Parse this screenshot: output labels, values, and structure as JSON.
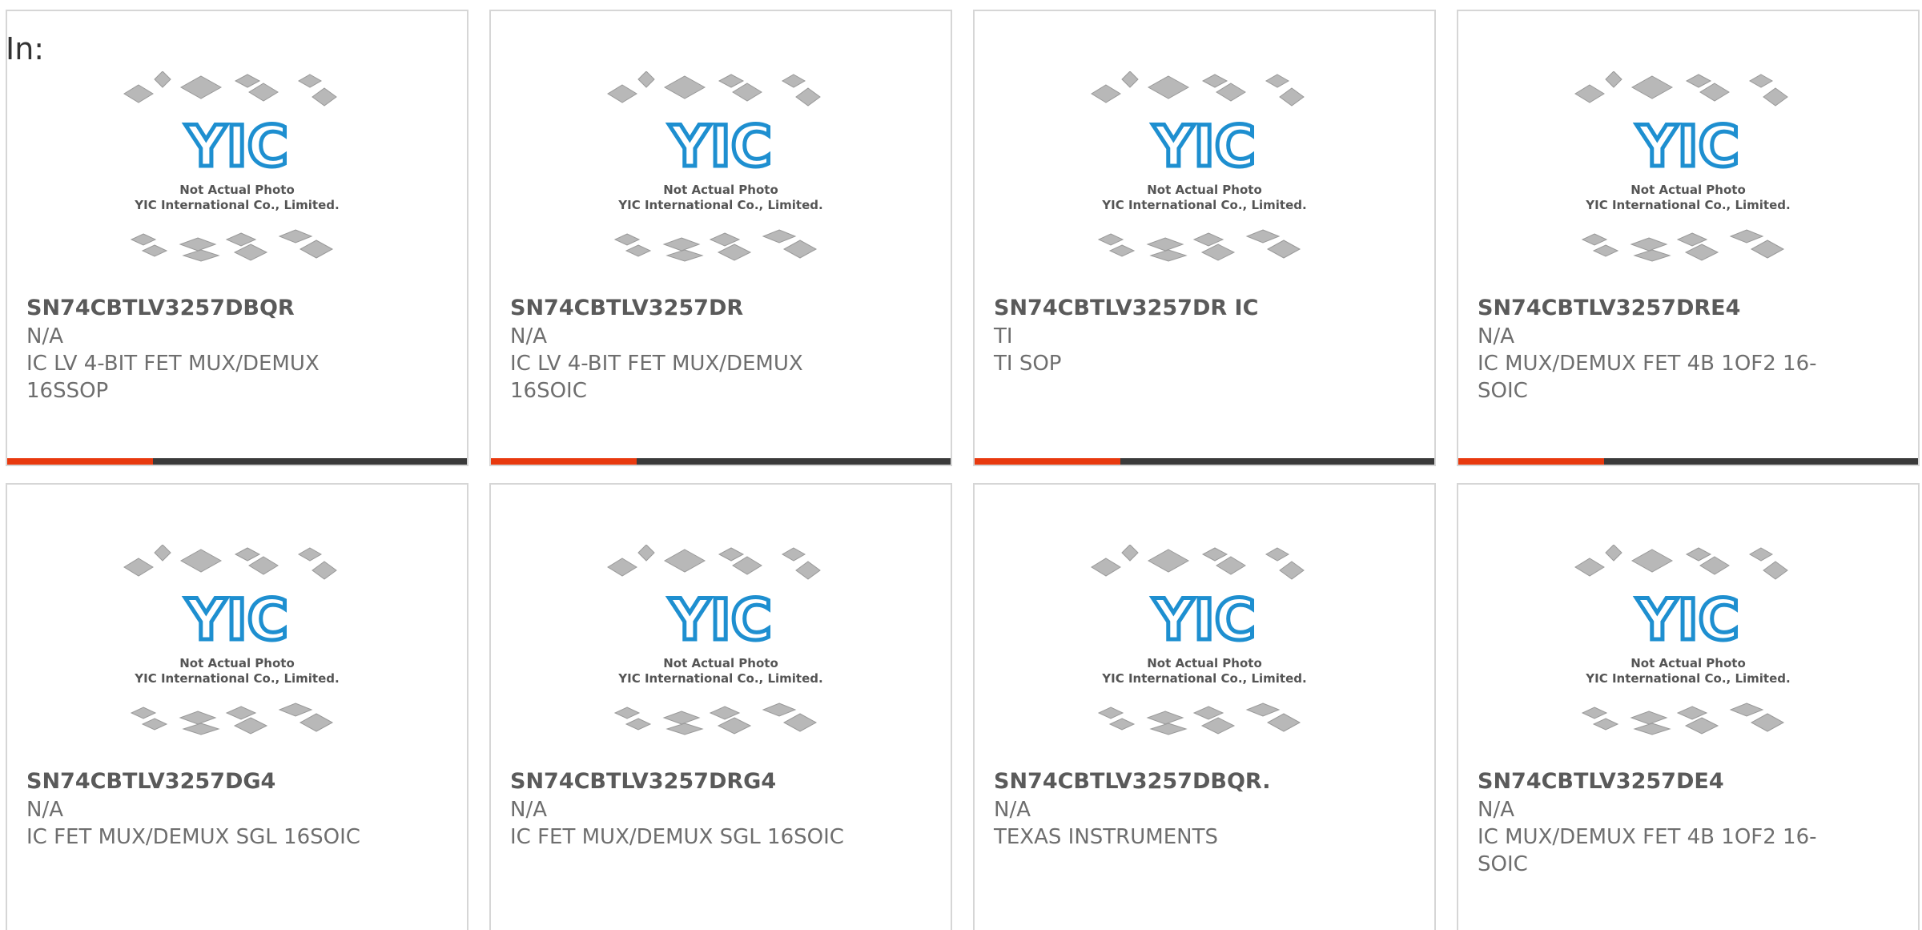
{
  "page": {
    "in_label": "In:"
  },
  "placeholder": {
    "line1": "Not Actual Photo",
    "line2": "YIC International Co., Limited.",
    "logo_text": "YIC"
  },
  "colors": {
    "accent": "#e8390e",
    "bar_dark": "#3a3a3a",
    "logo_blue": "#1e8fd0",
    "chip_gray": "#b8b8b8"
  },
  "products": [
    {
      "part": "SN74CBTLV3257DBQR",
      "mfr": "N/A",
      "desc": "IC LV 4-BIT FET MUX/DEMUX 16SSOP"
    },
    {
      "part": "SN74CBTLV3257DR",
      "mfr": "N/A",
      "desc": "IC LV 4-BIT FET MUX/DEMUX 16SOIC"
    },
    {
      "part": "SN74CBTLV3257DR IC",
      "mfr": "TI",
      "desc": "TI SOP"
    },
    {
      "part": "SN74CBTLV3257DRE4",
      "mfr": "N/A",
      "desc": "IC MUX/DEMUX FET 4B 1OF2 16-SOIC"
    },
    {
      "part": "SN74CBTLV3257DG4",
      "mfr": "N/A",
      "desc": "IC FET MUX/DEMUX SGL 16SOIC"
    },
    {
      "part": "SN74CBTLV3257DRG4",
      "mfr": "N/A",
      "desc": "IC FET MUX/DEMUX SGL 16SOIC"
    },
    {
      "part": "SN74CBTLV3257DBQR.",
      "mfr": "N/A",
      "desc": "TEXAS INSTRUMENTS"
    },
    {
      "part": "SN74CBTLV3257DE4",
      "mfr": "N/A",
      "desc": "IC MUX/DEMUX FET 4B 1OF2 16-SOIC"
    }
  ]
}
